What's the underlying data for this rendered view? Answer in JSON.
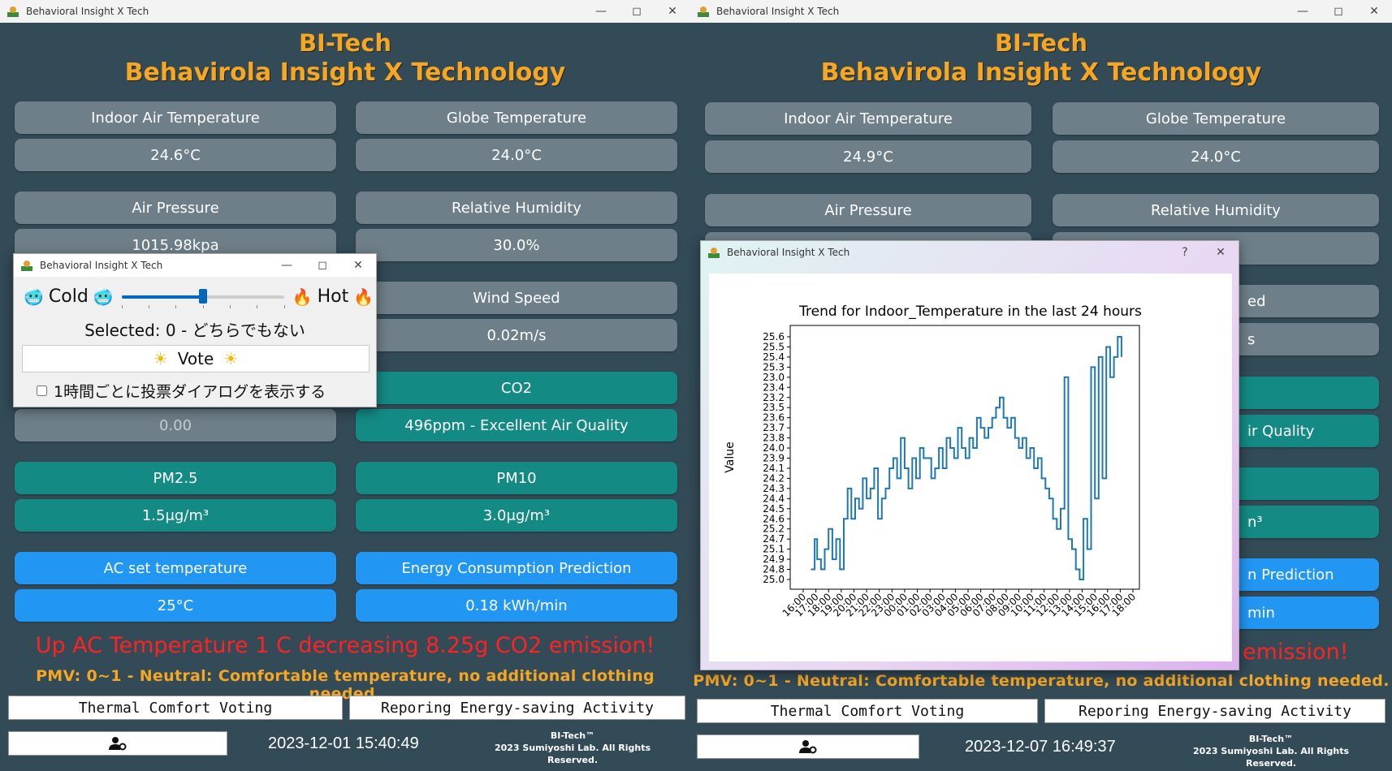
{
  "left": {
    "window_title": "Behavioral Insight X Tech",
    "header_line1": "BI-Tech",
    "header_line2": "Behavirola Insight X Technology",
    "indoor_label": "Indoor Air Temperature",
    "indoor_value": "24.6°C",
    "globe_label": "Globe Temperature",
    "globe_value": "24.0°C",
    "pressure_label": "Air Pressure",
    "pressure_value": "1015.98kpa",
    "humidity_label": "Relative Humidity",
    "humidity_value": "30.0%",
    "wind_label": "Wind Speed",
    "wind_value": "0.02m/s",
    "co2_label": "CO2",
    "co2_value": "496ppm - Excellent Air Quality",
    "hidden_value": "0.00",
    "pm25_label": "PM2.5",
    "pm25_value": "1.5μg/m³",
    "pm10_label": "PM10",
    "pm10_value": "3.0μg/m³",
    "ac_label": "AC set temperature",
    "ac_value": "25°C",
    "energy_label": "Energy Consumption Prediction",
    "energy_value": "0.18 kWh/min",
    "advice": "Up AC Temperature 1 C decreasing 8.25g CO2 emission!",
    "pmv": "PMV: 0~1 - Neutral: Comfortable temperature, no additional clothing needed.",
    "btn_voting": "Thermal Comfort Voting",
    "btn_energy": "Reporing Energy-saving Activity",
    "timestamp": "2023-12-01 15:40:49",
    "copy1": "BI-Tech™",
    "copy2": "2023 Sumiyoshi Lab. All Rights Reserved."
  },
  "vote_dialog": {
    "title": "Behavioral Insight X Tech",
    "cold": "Cold",
    "hot": "Hot",
    "slider_level": 0.5,
    "selected": "Selected: 0 - どちらでもない",
    "vote": "Vote",
    "checkbox": "1時間ごとに投票ダイアログを表示する"
  },
  "right": {
    "window_title": "Behavioral Insight X Tech",
    "header_line1": "BI-Tech",
    "header_line2": "Behavirola Insight X Technology",
    "indoor_label": "Indoor Air Temperature",
    "indoor_value": "24.9°C",
    "globe_label": "Globe Temperature",
    "globe_value": "24.0°C",
    "pressure_label": "Air Pressure",
    "humidity_label": "Relative Humidity",
    "wind_partial": "ed",
    "wind_value_partial": "s",
    "co2_value_partial": "ir Quality",
    "pm10_value_partial": "n³",
    "energy_label_partial": "n Prediction",
    "energy_value_partial": "min",
    "advice_partial": "emission!",
    "pmv": "PMV: 0~1 - Neutral: Comfortable temperature, no additional clothing needed.",
    "btn_voting": "Thermal Comfort Voting",
    "btn_energy": "Reporing Energy-saving Activity",
    "timestamp": "2023-12-07 16:49:37",
    "copy1": "BI-Tech™",
    "copy2": "2023 Sumiyoshi Lab. All Rights Reserved."
  },
  "trend_dialog": {
    "title": "Behavioral Insight X Tech",
    "help": "?"
  },
  "chart_data": {
    "type": "line",
    "title": "Trend for Indoor_Temperature in the last 24 hours",
    "ylabel": "Value",
    "xlabel": "",
    "y_categories": [
      "25.0",
      "24.8",
      "24.9",
      "25.1",
      "24.7",
      "25.2",
      "24.6",
      "24.5",
      "24.4",
      "24.3",
      "24.2",
      "24.1",
      "23.9",
      "24.0",
      "23.8",
      "23.7",
      "23.6",
      "23.5",
      "23.2",
      "23.4",
      "23.0",
      "25.3",
      "25.4",
      "25.5",
      "25.6"
    ],
    "x_ticks": [
      "16:00",
      "17:00",
      "18:00",
      "19:00",
      "20:00",
      "21:00",
      "22:00",
      "23:00",
      "00:00",
      "01:00",
      "02:00",
      "03:00",
      "04:00",
      "05:00",
      "06:00",
      "07:00",
      "08:00",
      "09:00",
      "10:00",
      "11:00",
      "12:00",
      "13:00",
      "14:00",
      "15:00",
      "16:00",
      "17:00",
      "18:00"
    ],
    "x": [
      0.6,
      0.9,
      1.1,
      1.4,
      1.7,
      2.0,
      2.3,
      2.6,
      2.9,
      3.2,
      3.5,
      3.8,
      4.1,
      4.4,
      4.7,
      5.0,
      5.3,
      5.6,
      5.9,
      6.2,
      6.5,
      6.8,
      7.1,
      7.4,
      7.7,
      8.0,
      8.3,
      8.6,
      8.9,
      9.2,
      9.5,
      9.8,
      10.1,
      10.4,
      10.7,
      11.0,
      11.3,
      11.6,
      11.9,
      12.2,
      12.5,
      12.8,
      13.1,
      13.4,
      13.7,
      14.0,
      14.3,
      14.6,
      14.9,
      15.2,
      15.5,
      15.8,
      16.1,
      16.4,
      16.7,
      17.0,
      17.3,
      17.6,
      17.9,
      18.2,
      18.5,
      18.8,
      19.1,
      19.4,
      19.7,
      20.0,
      20.3,
      20.6,
      20.9,
      21.2,
      21.5,
      21.8,
      22.1,
      22.4,
      22.7,
      23.0,
      23.3,
      23.6,
      23.9,
      24.2,
      24.5,
      24.8,
      25.1
    ],
    "y_index": [
      1,
      4,
      2,
      1,
      3,
      5,
      2,
      4,
      1,
      6,
      9,
      6,
      8,
      7,
      10,
      8,
      9,
      11,
      6,
      8,
      9,
      11,
      12,
      10,
      14,
      11,
      9,
      12,
      10,
      13,
      12,
      12,
      10,
      11,
      13,
      11,
      14,
      13,
      12,
      15,
      13,
      12,
      14,
      13,
      16,
      15,
      14,
      15,
      16,
      17,
      18,
      16,
      15,
      16,
      14,
      13,
      14,
      12,
      13,
      11,
      12,
      10,
      9,
      8,
      6,
      5,
      7,
      20,
      4,
      3,
      1,
      0,
      6,
      3,
      21,
      8,
      22,
      10,
      23,
      20,
      22,
      24,
      22
    ],
    "grid": false
  }
}
